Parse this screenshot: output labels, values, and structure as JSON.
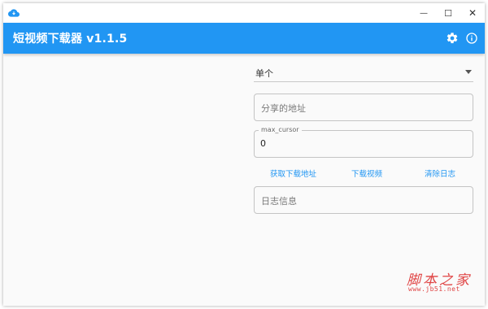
{
  "app": {
    "title": "短视频下载器 v1.1.5"
  },
  "window_controls": {
    "minimize": "—",
    "maximize": "☐",
    "close": "✕"
  },
  "appbar_icons": {
    "settings": "gear-icon",
    "info": "info-icon"
  },
  "form": {
    "mode_select": {
      "value": "单个"
    },
    "share_url": {
      "placeholder": "分享的地址",
      "value": ""
    },
    "max_cursor": {
      "label": "max_cursor",
      "value": "0"
    },
    "log": {
      "placeholder": "日志信息",
      "value": ""
    }
  },
  "actions": {
    "get_download_url": "获取下载地址",
    "download_video": "下载视频",
    "clear_log": "清除日志"
  },
  "watermark": {
    "main": "脚本之家",
    "sub": "www.jb51.net"
  },
  "colors": {
    "accent": "#2196f3",
    "watermark": "#e04545"
  }
}
